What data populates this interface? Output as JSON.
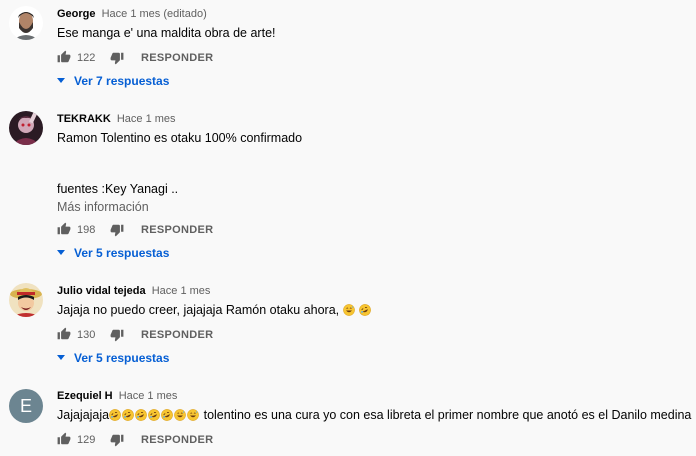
{
  "comments": [
    {
      "author": "George",
      "time": "Hace 1 mes (editado)",
      "text": "Ese manga e' una maldita obra de arte!",
      "likes": "122",
      "reply_label": "RESPONDER",
      "replies_label": "Ver 7 respuestas",
      "avatar_icon": "bearded-man-avatar"
    },
    {
      "author": "TEKRAKK",
      "time": "Hace 1 mes",
      "text": "Ramon Tolentino es otaku 100% confirmado",
      "extra_text": "fuentes :Key Yanagi ..",
      "more_label": "Más información",
      "likes": "198",
      "reply_label": "RESPONDER",
      "replies_label": "Ver 5 respuestas",
      "avatar_icon": "dark-figure-avatar"
    },
    {
      "author": "Julio vidal tejeda",
      "time": "Hace 1 mes",
      "text": "Jajaja no puedo creer, jajajaja Ramón otaku ahora,",
      "emoji_count": 2,
      "likes": "130",
      "reply_label": "RESPONDER",
      "replies_label": "Ver 5 respuestas",
      "avatar_icon": "anime-straw-hat-avatar"
    },
    {
      "author": "Ezequiel H",
      "time": "Hace 1 mes",
      "text_prefix": "Jajajajaja",
      "emoji_count": 7,
      "text_suffix": " tolentino es una cura yo con esa libreta el primer nombre que anotó es el Danilo medina",
      "avatar_letter": "E",
      "likes": "129",
      "reply_label": "RESPONDER"
    }
  ],
  "colors": {
    "background": "#f9f9f9",
    "link_blue": "#065fd4",
    "secondary_text": "#606060",
    "letter_avatar": "#6c8591"
  }
}
